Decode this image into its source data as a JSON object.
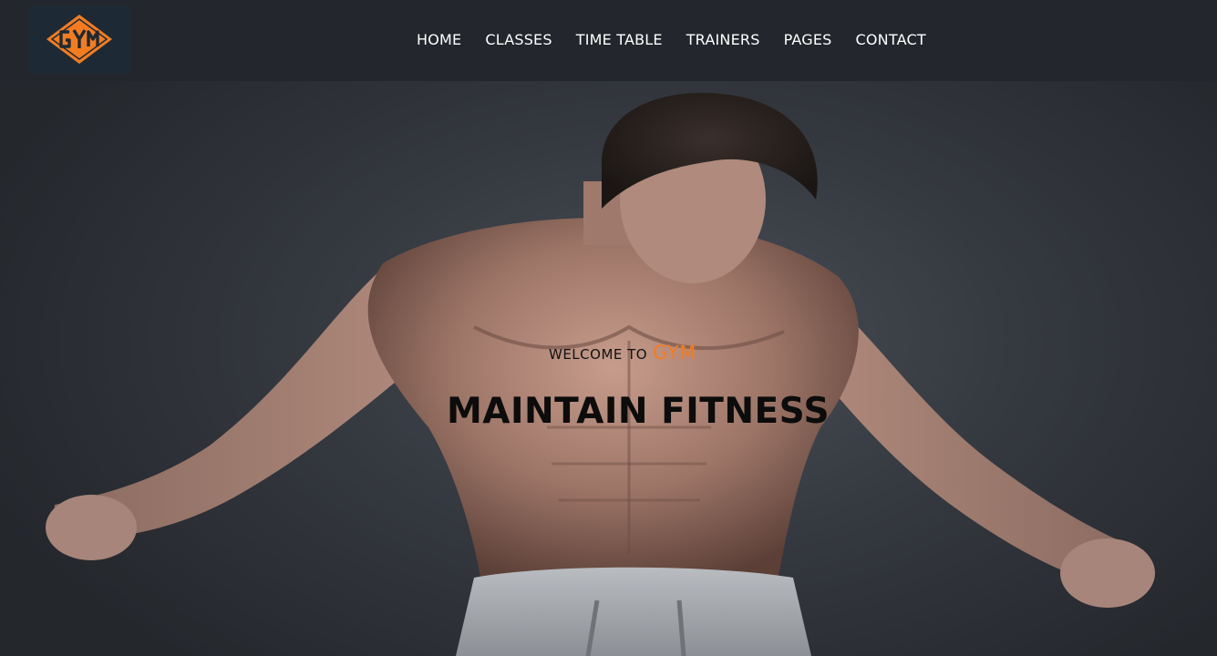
{
  "logo": {
    "icon": "gym-logo-icon",
    "accent": "#f47c20",
    "background": "#1d2a35"
  },
  "nav": {
    "items": [
      {
        "label": "HOME"
      },
      {
        "label": "CLASSES"
      },
      {
        "label": "TIME TABLE"
      },
      {
        "label": "TRAINERS"
      },
      {
        "label": "PAGES"
      },
      {
        "label": "CONTACT"
      }
    ]
  },
  "hero": {
    "welcome_text": "WELCOME TO",
    "brand": "GYM",
    "headline": "MAINTAIN FITNESS",
    "image": "muscular-man-photo"
  },
  "colors": {
    "accent": "#f47c20",
    "nav_bg": "#23262c",
    "nav_text": "#ffffff"
  }
}
